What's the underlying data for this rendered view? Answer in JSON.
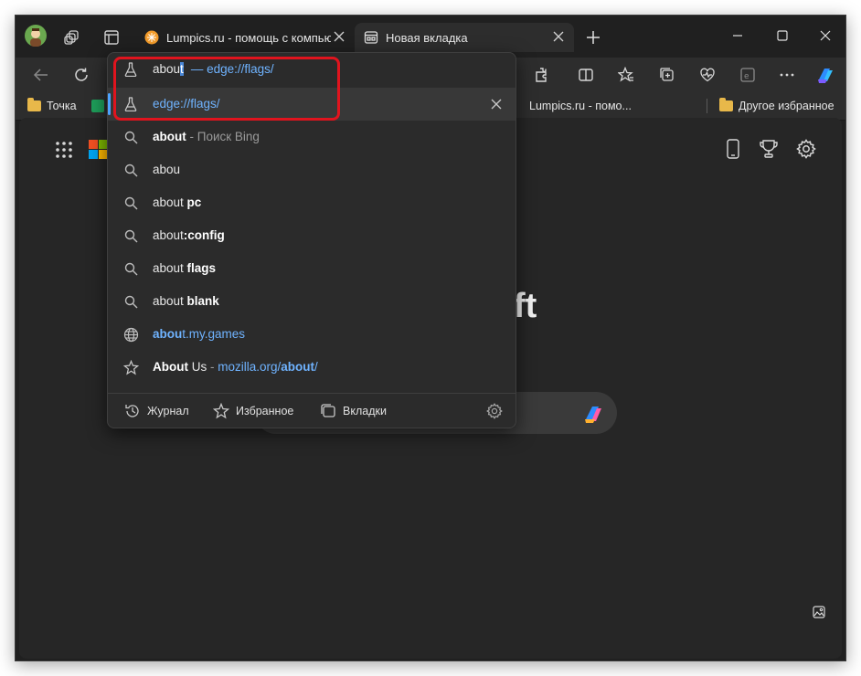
{
  "tabs": [
    {
      "title": "Lumpics.ru - помощь с компьюте",
      "active": false
    },
    {
      "title": "Новая вкладка",
      "active": true
    }
  ],
  "omnibox": {
    "typed": "abou",
    "autocomplete_rest": "t",
    "inline_suggestion": "— edge://flags/"
  },
  "favorites": {
    "items": [
      {
        "label": "Точка"
      },
      {
        "label": "Lumpics.ru - помо..."
      }
    ],
    "other_label": "Другое избранное"
  },
  "suggestions": [
    {
      "icon": "flask-icon",
      "parts": [
        {
          "t": "edge://flags/",
          "s": "link"
        }
      ],
      "selected": true,
      "removable": true
    },
    {
      "icon": "search-icon",
      "parts": [
        {
          "t": "about",
          "s": "b"
        },
        {
          "t": " - Поиск Bing",
          "s": "muted"
        }
      ]
    },
    {
      "icon": "search-icon",
      "parts": [
        {
          "t": "abou",
          "s": ""
        }
      ]
    },
    {
      "icon": "search-icon",
      "parts": [
        {
          "t": "about",
          "s": ""
        },
        {
          "t": " pc",
          "s": "b"
        }
      ]
    },
    {
      "icon": "search-icon",
      "parts": [
        {
          "t": "about",
          "s": ""
        },
        {
          "t": ":config",
          "s": "b"
        }
      ]
    },
    {
      "icon": "search-icon",
      "parts": [
        {
          "t": "about",
          "s": ""
        },
        {
          "t": " flags",
          "s": "b"
        }
      ]
    },
    {
      "icon": "search-icon",
      "parts": [
        {
          "t": "about",
          "s": ""
        },
        {
          "t": " blank",
          "s": "b"
        }
      ]
    },
    {
      "icon": "globe-icon",
      "parts": [
        {
          "t": "abou",
          "s": "link b"
        },
        {
          "t": "t.my.games",
          "s": "link"
        }
      ]
    },
    {
      "icon": "star-icon",
      "parts": [
        {
          "t": "About",
          "s": "b"
        },
        {
          "t": " Us",
          "s": ""
        },
        {
          "t": " - ",
          "s": "muted"
        },
        {
          "t": "mozilla.org/",
          "s": "link"
        },
        {
          "t": "about",
          "s": "link b"
        },
        {
          "t": "/",
          "s": "link"
        }
      ]
    }
  ],
  "footer": {
    "history_label": "Журнал",
    "favorites_label": "Избранное",
    "tabs_label": "Вкладки"
  },
  "ntp": {
    "partial_text": "ft"
  },
  "colors": {
    "accent": "#4da3ff",
    "highlight": "#e0141e",
    "link": "#6fb3ff"
  }
}
